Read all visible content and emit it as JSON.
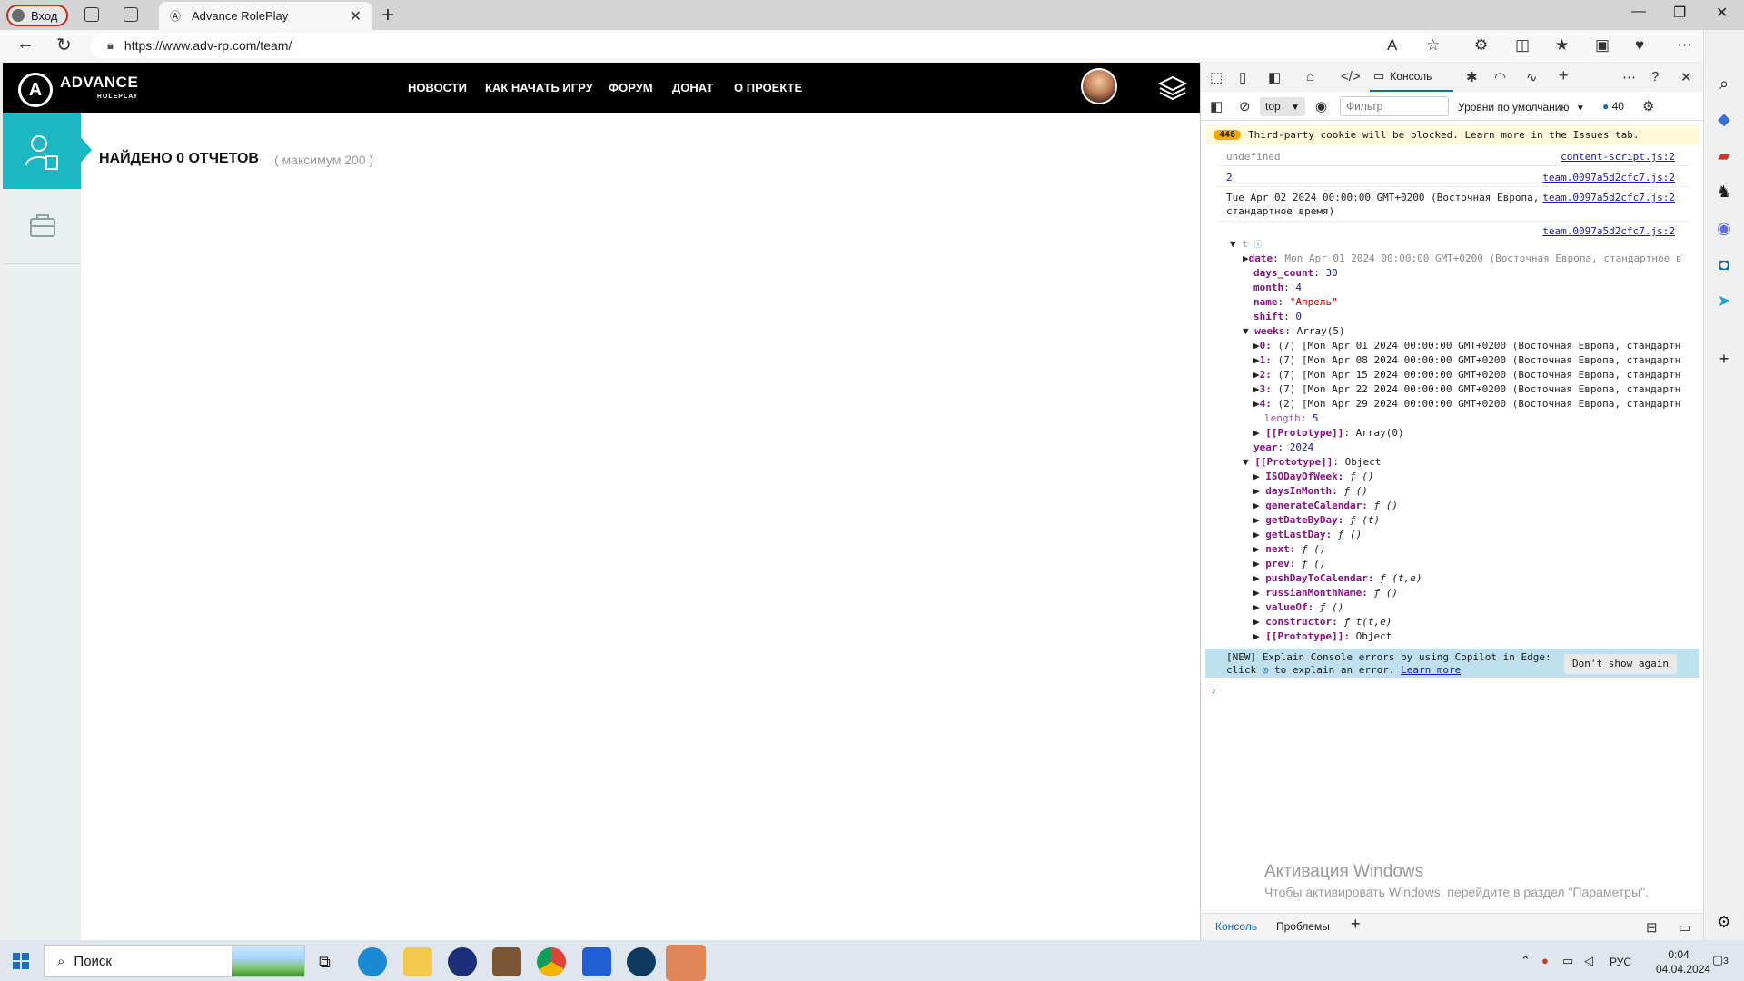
{
  "browser": {
    "profile_label": "Вход",
    "tab_title": "Advance RolePlay",
    "url": "https://www.adv-rp.com/team/"
  },
  "site": {
    "logo_text": "ADVANCE",
    "logo_sub": "ROLEPLAY",
    "nav": [
      "НОВОСТИ",
      "КАК НАЧАТЬ ИГРУ",
      "ФОРУМ",
      "ДОНАТ",
      "О ПРОЕКТЕ"
    ],
    "title": "НАЙДЕНО 0 ОТЧЕТОВ",
    "subtitle": "( максимум 200 )",
    "accent": "#1cb7c3"
  },
  "devtools": {
    "console_tab": "Консоль",
    "context": "top",
    "filter_placeholder": "Фильтр",
    "levels": "Уровни по умолчанию",
    "issues_count": "40",
    "warning_count": "446",
    "warning_text": "Third-party cookie will be blocked. Learn more in the Issues tab.",
    "logs": [
      {
        "text": "undefined",
        "src": "content-script.js:2"
      },
      {
        "text": "2",
        "src": "team.0097a5d2cfc7.js:2"
      },
      {
        "text": "Tue Apr 02 2024 00:00:00 GMT+0200 (Восточная Европа,",
        "text2": "стандартное время)",
        "src": "team.0097a5d2cfc7.js:2"
      },
      {
        "text": "",
        "src": "team.0097a5d2cfc7.js:2"
      }
    ],
    "object": {
      "head": "t",
      "date_key": "date",
      "date_val": "Mon Apr 01 2024 00:00:00 GMT+0200 (Восточная Европа, стандартное в",
      "days_count_key": "days_count",
      "days_count_val": "30",
      "month_key": "month",
      "month_val": "4",
      "name_key": "name",
      "name_val": "\"Апрель\"",
      "shift_key": "shift",
      "shift_val": "0",
      "weeks_key": "weeks",
      "weeks_val": "Array(5)",
      "weeks": [
        {
          "k": "0:",
          "v": "(7) [Mon Apr 01 2024 00:00:00 GMT+0200 (Восточная Европа, стандартн"
        },
        {
          "k": "1:",
          "v": "(7) [Mon Apr 08 2024 00:00:00 GMT+0200 (Восточная Европа, стандартн"
        },
        {
          "k": "2:",
          "v": "(7) [Mon Apr 15 2024 00:00:00 GMT+0200 (Восточная Европа, стандартн"
        },
        {
          "k": "3:",
          "v": "(7) [Mon Apr 22 2024 00:00:00 GMT+0200 (Восточная Европа, стандартн"
        },
        {
          "k": "4:",
          "v": "(2) [Mon Apr 29 2024 00:00:00 GMT+0200 (Восточная Европа, стандартн"
        }
      ],
      "length_key": "length",
      "length_val": "5",
      "weeks_proto_key": "[[Prototype]]",
      "weeks_proto_val": "Array(0)",
      "year_key": "year",
      "year_val": "2024",
      "proto_key": "[[Prototype]]",
      "proto_val": "Object",
      "methods": [
        {
          "k": "ISODayOfWeek:",
          "v": "ƒ ()"
        },
        {
          "k": "daysInMonth:",
          "v": "ƒ ()"
        },
        {
          "k": "generateCalendar:",
          "v": "ƒ ()"
        },
        {
          "k": "getDateByDay:",
          "v": "ƒ (t)"
        },
        {
          "k": "getLastDay:",
          "v": "ƒ ()"
        },
        {
          "k": "next:",
          "v": "ƒ ()"
        },
        {
          "k": "prev:",
          "v": "ƒ ()"
        },
        {
          "k": "pushDayToCalendar:",
          "v": "ƒ (t,e)"
        },
        {
          "k": "russianMonthName:",
          "v": "ƒ ()"
        },
        {
          "k": "valueOf:",
          "v": "ƒ ()"
        },
        {
          "k": "constructor:",
          "v": "ƒ t(t,e)"
        },
        {
          "k": "[[Prototype]]:",
          "v": "Object"
        }
      ]
    },
    "copilot_line1": "[NEW] Explain Console errors by using Copilot in Edge:",
    "copilot_line2a": "click",
    "copilot_line2b": "to explain an error.",
    "copilot_link": "Learn more",
    "dont_show": "Don't show again",
    "bottom_tabs": [
      "Консоль",
      "Проблемы"
    ]
  },
  "watermark": {
    "line1": "Активация Windows",
    "line2": "Чтобы активировать Windows, перейдите в раздел \"Параметры\"."
  },
  "taskbar": {
    "search": "Поиск",
    "lang": "РУС",
    "time": "0:04",
    "date": "04.04.2024",
    "notif_count": "3"
  }
}
